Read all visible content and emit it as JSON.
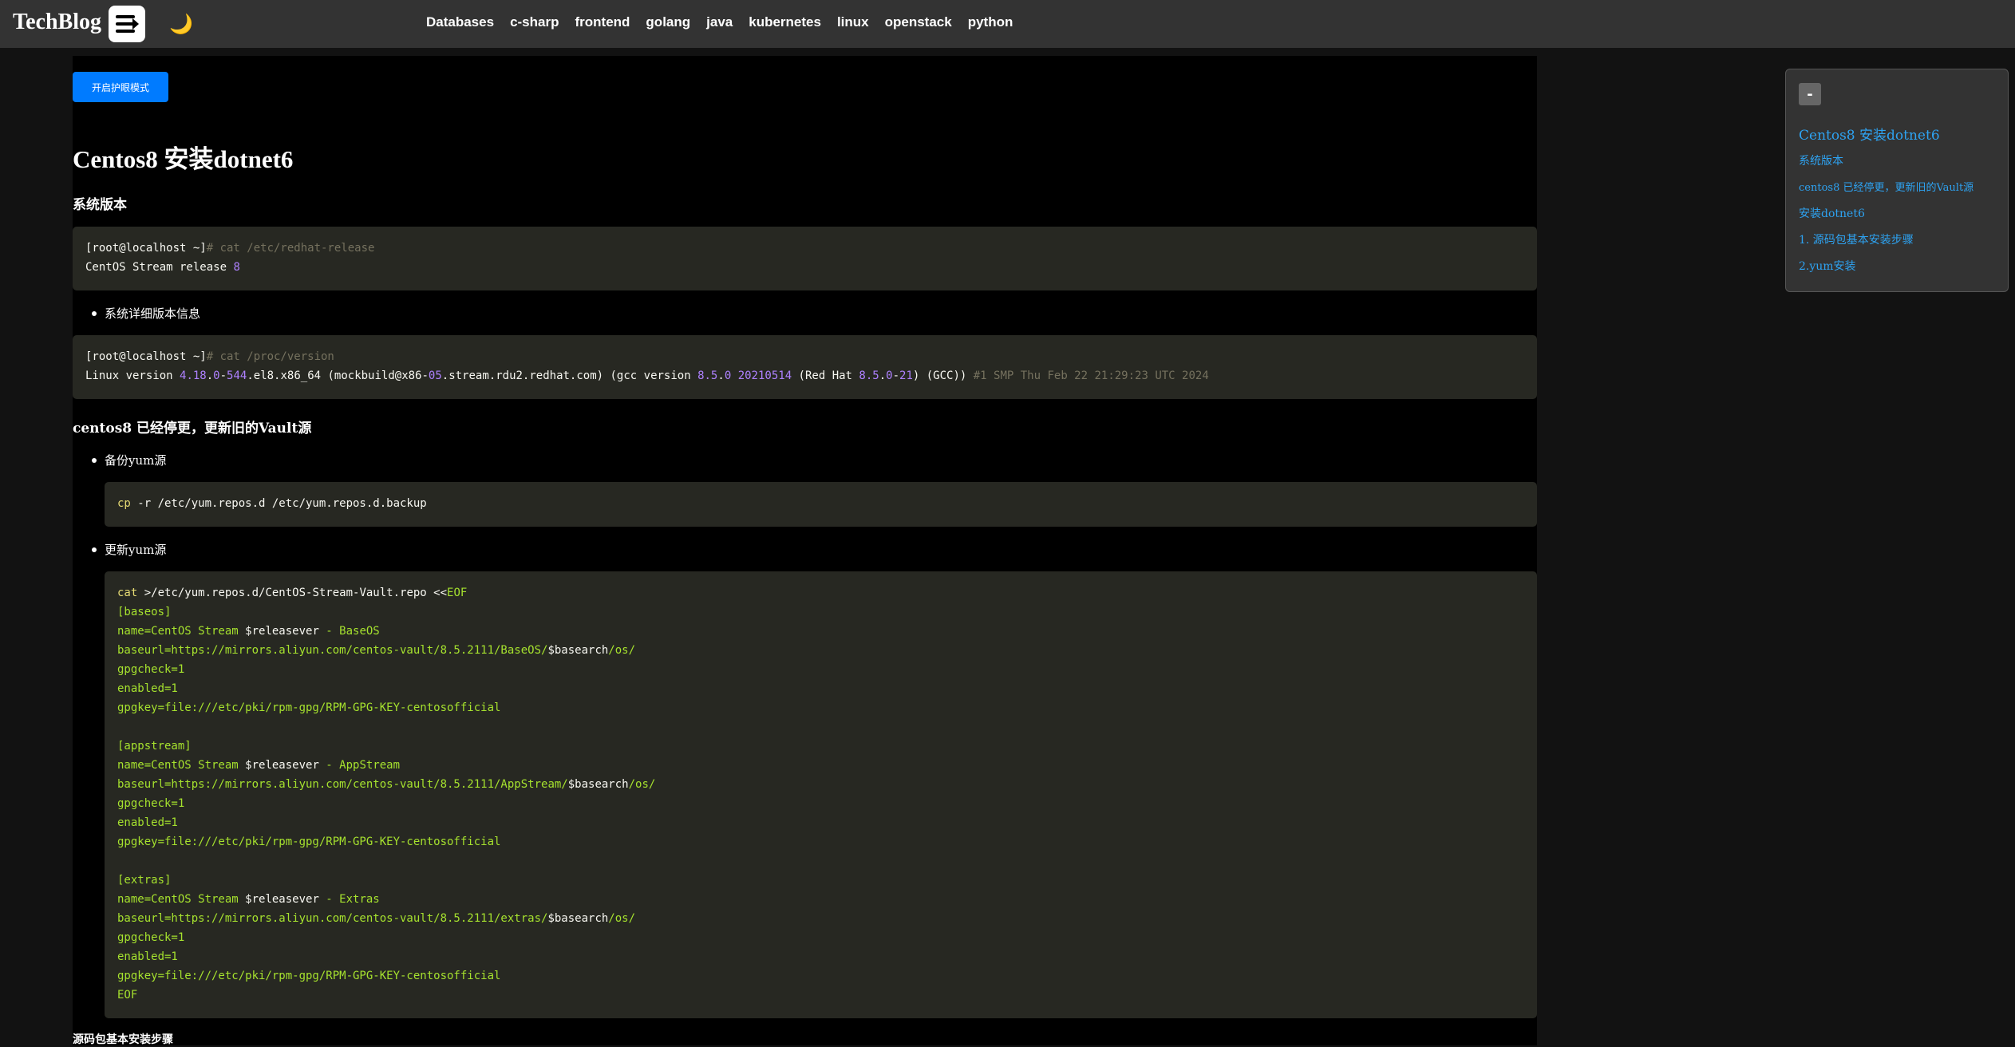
{
  "navbar": {
    "brand": "TechBlog",
    "links": [
      "Databases",
      "c-sharp",
      "frontend",
      "golang",
      "java",
      "kubernetes",
      "linux",
      "openstack",
      "python"
    ]
  },
  "article": {
    "eye_button": "开启护眼模式",
    "title": "Centos8 安装dotnet6",
    "section1": "系统版本",
    "bullet1": "系统详细版本信息",
    "section2": "centos8 已经停更，更新旧的Vault源",
    "bullet2": "备份yum源",
    "bullet3": "更新yum源",
    "section3_partial": "源码包基本安装步骤"
  },
  "code": {
    "release_prompt": "[root@localhost ~]",
    "release_cmd": "# cat /etc/redhat-release",
    "release_out_text": "CentOS Stream release ",
    "release_out_num": "8",
    "version_prompt": "[root@localhost ~]",
    "version_cmd": "# cat /proc/version",
    "version_out": "Linux version 4.18.0-544.el8.x86_64 (mockbuild@x86-05.stream.rdu2.redhat.com) (gcc version 8.5.0 20210514 (Red Hat 8.5.0-21) (GCC)) #1 SMP Thu Feb 22 21:29:23 UTC 2024",
    "backup_cmd": "cp -r /etc/yum.repos.d /etc/yum.repos.d.backup",
    "repo_lines": [
      "cat >/etc/yum.repos.d/CentOS-Stream-Vault.repo <<EOF",
      "[baseos]",
      "name=CentOS Stream $releasever - BaseOS",
      "baseurl=https://mirrors.aliyun.com/centos-vault/8.5.2111/BaseOS/$basearch/os/",
      "gpgcheck=1",
      "enabled=1",
      "gpgkey=file:///etc/pki/rpm-gpg/RPM-GPG-KEY-centosofficial",
      "",
      "[appstream]",
      "name=CentOS Stream $releasever - AppStream",
      "baseurl=https://mirrors.aliyun.com/centos-vault/8.5.2111/AppStream/$basearch/os/",
      "gpgcheck=1",
      "enabled=1",
      "gpgkey=file:///etc/pki/rpm-gpg/RPM-GPG-KEY-centosofficial",
      "",
      "[extras]",
      "name=CentOS Stream $releasever - Extras",
      "baseurl=https://mirrors.aliyun.com/centos-vault/8.5.2111/extras/$basearch/os/",
      "gpgcheck=1",
      "enabled=1",
      "gpgkey=file:///etc/pki/rpm-gpg/RPM-GPG-KEY-centosofficial",
      "EOF"
    ]
  },
  "toc": {
    "toggle": "-",
    "items": [
      "Centos8 安装dotnet6",
      "系统版本",
      "centos8 已经停更，更新旧的Vault源",
      "安装dotnet6",
      "1. 源码包基本安装步骤",
      "2.yum安装"
    ]
  },
  "colors": {
    "navbar_bg": "#333333",
    "page_bg": "#121212",
    "article_bg": "#000000",
    "code_bg": "#272822",
    "accent_button": "#007bff",
    "toc_link": "#2ea3f2"
  },
  "icons": {
    "menu": "menu-toggle-icon",
    "theme": "moon-icon"
  }
}
